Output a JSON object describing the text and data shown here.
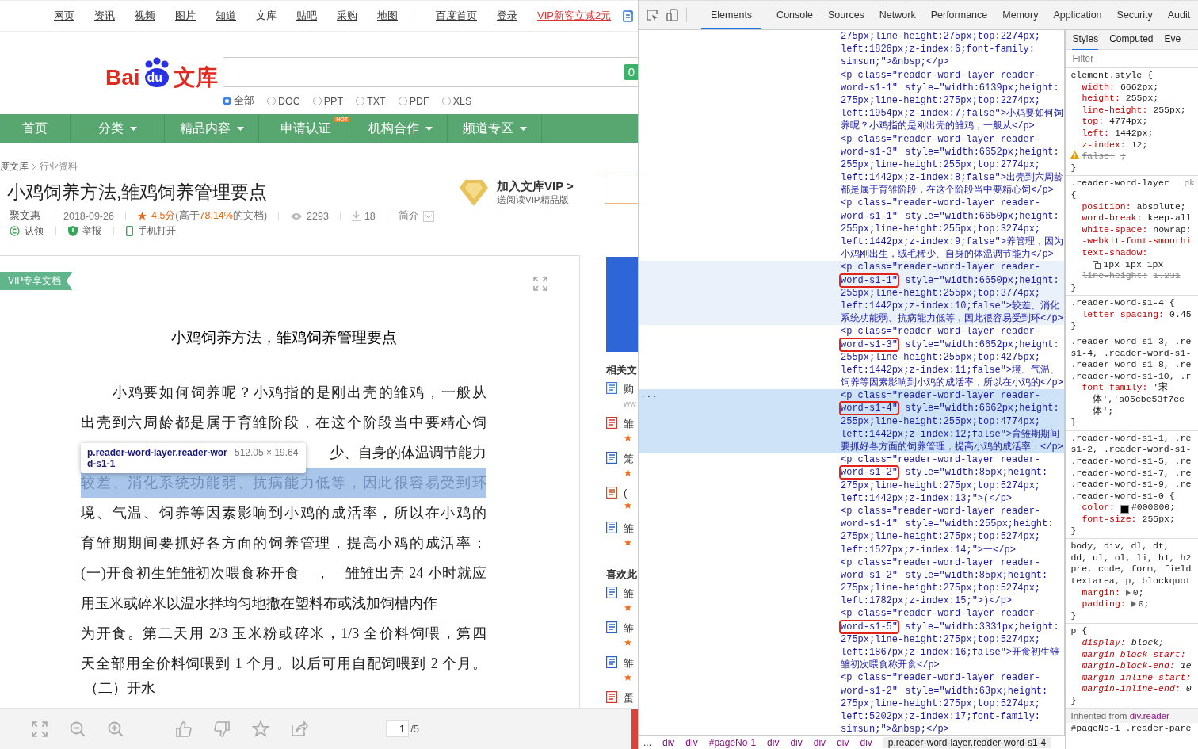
{
  "site": {
    "top_links": [
      {
        "label": "网页",
        "selected": false
      },
      {
        "label": "资讯",
        "selected": false
      },
      {
        "label": "视频",
        "selected": false
      },
      {
        "label": "图片",
        "selected": false
      },
      {
        "label": "知道",
        "selected": false
      },
      {
        "label": "文库",
        "selected": true
      },
      {
        "label": "贴吧",
        "selected": false
      },
      {
        "label": "采购",
        "selected": false
      },
      {
        "label": "地图",
        "selected": false
      }
    ],
    "right_links": [
      {
        "label": "百度首页",
        "kind": "plain"
      },
      {
        "label": "登录",
        "kind": "plain"
      },
      {
        "label": "VIP新客立减2元",
        "kind": "promo"
      }
    ],
    "logo": {
      "left": "Bai",
      "paw": "du",
      "right": "文库"
    },
    "search_button": "0",
    "file_types": [
      {
        "label": "全部",
        "selected": true
      },
      {
        "label": "DOC",
        "selected": false
      },
      {
        "label": "PPT",
        "selected": false
      },
      {
        "label": "TXT",
        "selected": false
      },
      {
        "label": "PDF",
        "selected": false
      },
      {
        "label": "XLS",
        "selected": false
      }
    ],
    "nav": [
      {
        "label": "首页",
        "dropdown": false
      },
      {
        "label": "分类",
        "dropdown": true
      },
      {
        "label": "精品内容",
        "dropdown": true
      },
      {
        "label": "申请认证",
        "dropdown": false,
        "badge": "HOT"
      },
      {
        "label": "机构合作",
        "dropdown": true
      },
      {
        "label": "频道专区",
        "dropdown": true
      }
    ],
    "breadcrumb": [
      "度文库",
      "行业资料"
    ],
    "title": "小鸡饲养方法,雏鸡饲养管理要点",
    "meta": {
      "author": "聚文惠",
      "date": "2018-09-26",
      "rating": "4.5分",
      "compare_prefix": "(高于",
      "compare_percent": "78.14%",
      "compare_suffix": "的文档)",
      "views": "2293",
      "downloads": "18",
      "summary": "简介"
    },
    "actions": [
      "认领",
      "举报",
      "手机打开"
    ],
    "vip": {
      "title": "加入文库VIP >",
      "subtitle": "送阅读VIP精品版"
    },
    "document": {
      "badge": "VIP专享文档",
      "heading": "小鸡饲养方法，雏鸡饲养管理要点",
      "lines": [
        {
          "text": "小鸡要如何饲养呢？小鸡指的是刚出壳的雏鸡，一般从",
          "kind": "first",
          "highlighted": false
        },
        {
          "text": "出壳到六周龄都是属于育雏阶段，在这个阶段当中要精心饲",
          "kind": "body",
          "highlighted": false
        },
        {
          "text": "少、自身的体温调节能力",
          "kind": "covered",
          "highlighted": false
        },
        {
          "text": "较差、消化系统功能弱、抗病能力低等，因此很容易受到环",
          "kind": "body",
          "highlighted": true
        },
        {
          "text": "境、气温、饲养等因素影响到小鸡的成活率，所以在小鸡的",
          "kind": "body",
          "highlighted": false
        },
        {
          "text": "育雏期期间要抓好各方面的饲养管理，提高小鸡的成活率：",
          "kind": "body",
          "highlighted": false
        },
        {
          "text": "(一)开食初生雏雏初次喂食称开食　，　雏雏出壳 24 小时就应",
          "kind": "body",
          "highlighted": false
        },
        {
          "text": "用玉米或碎米以温水拌均匀地撒在塑料布或浅加饲槽内作",
          "kind": "short",
          "highlighted": false
        },
        {
          "text": "为开食。第二天用 2/3 玉米粉或碎米，1/3 全价料饲喂，第四",
          "kind": "body",
          "highlighted": false
        },
        {
          "text": "天全部用全价料饲喂到 1 个月。以后可用自配饲喂到 2 个月。",
          "kind": "body",
          "highlighted": false
        },
        {
          "text": "（二）开水",
          "kind": "cut",
          "highlighted": false
        }
      ],
      "tooltip": {
        "selector": "p.reader-word-layer.reader-word-s1-1",
        "size": "512.05 × 19.64"
      },
      "page": "1",
      "pages": "/5"
    },
    "related": {
      "sections": [
        {
          "heading": "相关文",
          "items": [
            {
              "kind": "link",
              "text": "购",
              "sub": "ww"
            },
            {
              "kind": "pdf",
              "text": "雏"
            },
            {
              "kind": "word",
              "text": "笼"
            },
            {
              "kind": "ppt",
              "text": "("
            },
            {
              "kind": "word",
              "text": "雏"
            }
          ]
        },
        {
          "heading": "喜欢此",
          "items": [
            {
              "kind": "word",
              "text": "雏"
            },
            {
              "kind": "word",
              "text": "雏"
            },
            {
              "kind": "word",
              "text": "雏"
            },
            {
              "kind": "pdf",
              "text": "蛋"
            }
          ]
        }
      ]
    }
  },
  "devtools": {
    "tabs": [
      {
        "label": "Elements",
        "selected": true
      },
      {
        "label": "Console",
        "selected": false
      },
      {
        "label": "Sources",
        "selected": false
      },
      {
        "label": "Network",
        "selected": false
      },
      {
        "label": "Performance",
        "selected": false
      },
      {
        "label": "Memory",
        "selected": false
      },
      {
        "label": "Application",
        "selected": false
      },
      {
        "label": "Security",
        "selected": false
      },
      {
        "label": "Audit",
        "selected": false
      }
    ],
    "nodes": [
      {
        "hovered": false,
        "selected": false,
        "lines": [
          "275px;line-height:275px;top:2274px;",
          "left:1826px;z-index:6;font-family:",
          "simsun;\">&nbsp;</p>"
        ]
      },
      {
        "hovered": false,
        "selected": false,
        "outlined": false,
        "class_tail": "word-s1-1\"",
        "lines": [
          "<p class=\"reader-word-layer reader-",
          " style=\"width:6139px;height:",
          "275px;line-height:275px;top:2274px;",
          "left:1954px;z-index:7;false\">小鸡要如何饲",
          "养呢？小鸡指的是刚出壳的雏鸡，一般从</p>"
        ]
      },
      {
        "hovered": false,
        "selected": false,
        "outlined": false,
        "class_tail": "word-s1-3\"",
        "lines": [
          "<p class=\"reader-word-layer reader-",
          " style=\"width:6652px;height:",
          "255px;line-height:255px;top:2774px;",
          "left:1442px;z-index:8;false\">出壳到六周龄",
          "都是属于育雏阶段，在这个阶段当中要精心饲</p>"
        ]
      },
      {
        "hovered": false,
        "selected": false,
        "outlined": false,
        "class_tail": "word-s1-1\"",
        "lines": [
          "<p class=\"reader-word-layer reader-",
          " style=\"width:6650px;height:",
          "255px;line-height:255px;top:3274px;",
          "left:1442px;z-index:9;false\">养管理，因为",
          "小鸡刚出生，绒毛稀少、自身的体温调节能力</p>"
        ]
      },
      {
        "hovered": true,
        "selected": false,
        "outlined": true,
        "class_tail": "word-s1-1\"",
        "lines": [
          "<p class=\"reader-word-layer reader-",
          " style=\"width:6650px;height:",
          "255px;line-height:255px;top:3774px;",
          "left:1442px;z-index:10;false\">较差、消化",
          "系统功能弱、抗病能力低等，因此很容易受到环</p>"
        ]
      },
      {
        "hovered": false,
        "selected": false,
        "outlined": true,
        "class_tail": "word-s1-3\"",
        "lines": [
          "<p class=\"reader-word-layer reader-",
          " style=\"width:6652px;height:",
          "255px;line-height:255px;top:4275px;",
          "left:1442px;z-index:11;false\">境、气温、",
          "饲养等因素影响到小鸡的成活率，所以在小鸡的</p>"
        ]
      },
      {
        "hovered": false,
        "selected": true,
        "outlined": true,
        "gutter": "...",
        "class_tail": "word-s1-4\"",
        "lines": [
          "<p class=\"reader-word-layer reader-",
          " style=\"width:6662px;height:",
          "255px;line-height:255px;top:4774px;",
          "left:1442px;z-index:12;false\">育雏期期间",
          "要抓好各方面的饲养管理，提高小鸡的成活率：</p>"
        ]
      },
      {
        "hovered": false,
        "selected": false,
        "outlined": true,
        "class_tail": "word-s1-2\"",
        "lines": [
          "<p class=\"reader-word-layer reader-",
          " style=\"width:85px;height:",
          "275px;line-height:275px;top:5274px;",
          "left:1442px;z-index:13;\">(</p>"
        ]
      },
      {
        "hovered": false,
        "selected": false,
        "outlined": false,
        "class_tail": "word-s1-1\"",
        "lines": [
          "<p class=\"reader-word-layer reader-",
          " style=\"width:255px;height:",
          "275px;line-height:275px;top:5274px;",
          "left:1527px;z-index:14;\">一</p>"
        ]
      },
      {
        "hovered": false,
        "selected": false,
        "outlined": false,
        "class_tail": "word-s1-2\"",
        "lines": [
          "<p class=\"reader-word-layer reader-",
          " style=\"width:85px;height:",
          "275px;line-height:275px;top:5274px;",
          "left:1782px;z-index:15;\">)</p>"
        ]
      },
      {
        "hovered": false,
        "selected": false,
        "outlined": true,
        "class_tail": "word-s1-5\"",
        "lines": [
          "<p class=\"reader-word-layer reader-",
          " style=\"width:3331px;height:",
          "275px;line-height:275px;top:5274px;",
          "left:1867px;z-index:16;false\">开食初生雏",
          "雏初次喂食称开食</p>"
        ]
      },
      {
        "hovered": false,
        "selected": false,
        "outlined": false,
        "class_tail": "word-s1-2\"",
        "lines": [
          "<p class=\"reader-word-layer reader-",
          " style=\"width:63px;height:",
          "275px;line-height:275px;top:5274px;",
          "left:5202px;z-index:17;font-family:",
          "simsun;\">&nbsp;</p>"
        ]
      }
    ],
    "crumbs": [
      {
        "label": "...",
        "selected": false
      },
      {
        "label": "div",
        "selected": false
      },
      {
        "label": "div",
        "selected": false
      },
      {
        "label": "#pageNo-1",
        "selected": false
      },
      {
        "label": "div",
        "selected": false
      },
      {
        "label": "div",
        "selected": false
      },
      {
        "label": "div",
        "selected": false
      },
      {
        "label": "div",
        "selected": false
      },
      {
        "label": "div",
        "selected": false
      },
      {
        "label": "p.reader-word-layer.reader-word-s1-4",
        "selected": true
      }
    ],
    "styles": {
      "tabs": [
        {
          "label": "Styles",
          "selected": true
        },
        {
          "label": "Computed",
          "selected": false
        },
        {
          "label": "Eve",
          "selected": false
        }
      ],
      "filter_placeholder": "Filter",
      "rules": [
        {
          "selector": [
            "element.style {"
          ],
          "user_agent": false,
          "decls": [
            {
              "kind": "decl",
              "name": "width:",
              "value": "6662px;",
              "struck": false
            },
            {
              "kind": "decl",
              "name": "height:",
              "value": "255px;",
              "struck": false
            },
            {
              "kind": "decl",
              "name": "line-height:",
              "value": "255px;",
              "struck": false
            },
            {
              "kind": "decl",
              "name": "top:",
              "value": "4774px;",
              "struck": false
            },
            {
              "kind": "decl",
              "name": "left:",
              "value": "1442px;",
              "struck": false
            },
            {
              "kind": "decl",
              "name": "z-index:",
              "value": "12;",
              "struck": false
            },
            {
              "kind": "warning",
              "name": "false:",
              "value": ";",
              "struck": true
            }
          ],
          "close": "}"
        },
        {
          "selector": [
            ".reader-word-layer",
            "{"
          ],
          "source": "pk",
          "user_agent": false,
          "decls": [
            {
              "kind": "decl",
              "name": "position:",
              "value": "absolute;",
              "struck": false
            },
            {
              "kind": "decl",
              "name": "word-break:",
              "value": "keep-all",
              "struck": false
            },
            {
              "kind": "decl",
              "name": "white-space:",
              "value": "nowrap;",
              "struck": false
            },
            {
              "kind": "decl",
              "name": "-webkit-font-smoothi",
              "struck": false
            },
            {
              "kind": "decl",
              "name": "text-shadow:",
              "struck": false
            },
            {
              "kind": "shadow",
              "value": "1px 1px 1px",
              "struck": false
            },
            {
              "kind": "decl",
              "name": "line-height:",
              "value": "1.231",
              "struck": true
            }
          ],
          "close": "}"
        },
        {
          "selector": [
            ".reader-word-s1-4 {"
          ],
          "user_agent": false,
          "decls": [
            {
              "kind": "decl",
              "name": "letter-spacing:",
              "value": "0.45",
              "struck": false
            }
          ],
          "close": "}"
        },
        {
          "selector": [
            ".reader-word-s1-3, .re",
            "s1-4, .reader-word-s1-",
            ".reader-word-s1-8, .re",
            ".reader-word-s1-10, .r"
          ],
          "user_agent": false,
          "decls": [
            {
              "kind": "decl",
              "name": "font-family:",
              "value": "'宋",
              "struck": false
            },
            {
              "kind": "cont",
              "value": "体','a05cbe53f7ec",
              "struck": false
            },
            {
              "kind": "cont",
              "value": "体';",
              "struck": false
            }
          ],
          "close": "}"
        },
        {
          "selector": [
            ".reader-word-s1-1, .re",
            "s1-2, .reader-word-s1-",
            ".reader-word-s1-5, .re",
            ".reader-word-s1-7, .re",
            ".reader-word-s1-9, .re",
            ".reader-word-s1-0 {"
          ],
          "user_agent": false,
          "decls": [
            {
              "kind": "color",
              "name": "color:",
              "value": "#000000;",
              "struck": false
            },
            {
              "kind": "decl",
              "name": "font-size:",
              "value": "255px;",
              "struck": false
            }
          ],
          "close": "}"
        },
        {
          "selector": [
            "body, div, dl, dt,",
            "dd, ul, ol, li, h1, h2",
            "pre, code, form, field",
            "textarea, p, blockquot"
          ],
          "user_agent": false,
          "decls": [
            {
              "kind": "expand",
              "name": "margin:",
              "value": "0;",
              "struck": false
            },
            {
              "kind": "expand",
              "name": "padding:",
              "value": "0;",
              "struck": false
            }
          ],
          "close": "}"
        },
        {
          "selector": [
            "p {"
          ],
          "user_agent": true,
          "decls": [
            {
              "kind": "decl",
              "name": "display:",
              "value": "block;",
              "struck": false
            },
            {
              "kind": "decl",
              "name": "margin-block-start:",
              "struck": false
            },
            {
              "kind": "decl",
              "name": "margin-block-end:",
              "value": "1e",
              "struck": false
            },
            {
              "kind": "decl",
              "name": "margin-inline-start:",
              "struck": false
            },
            {
              "kind": "decl",
              "name": "margin-inline-end:",
              "value": "0",
              "struck": false
            }
          ],
          "close": "}"
        }
      ],
      "inherited": "Inherited from",
      "inherited_from": "div.reader-",
      "last_selector": "#pageNo-1 .reader-pare"
    }
  }
}
